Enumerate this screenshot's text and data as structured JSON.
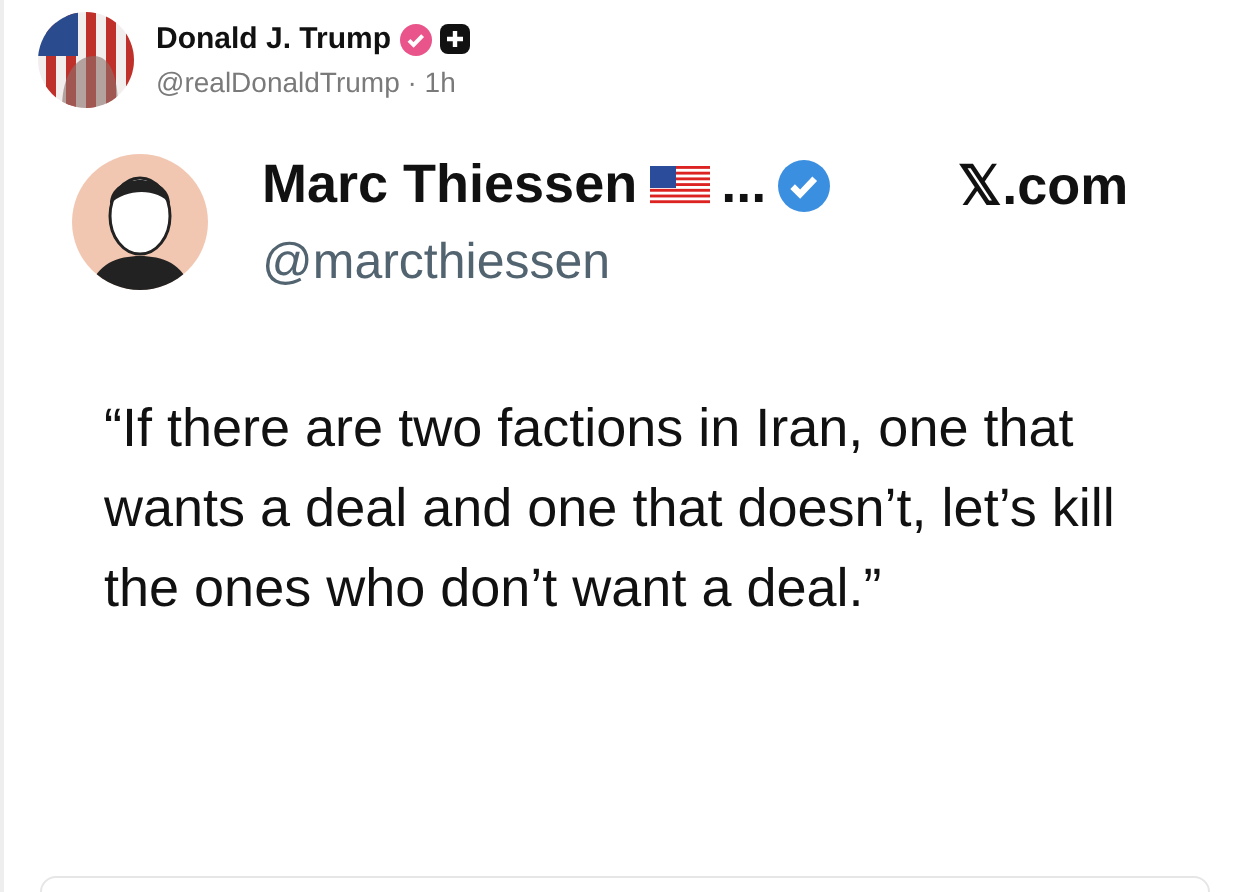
{
  "post": {
    "author": {
      "name": "Donald J. Trump",
      "meta": "@realDonaldTrump · 1h"
    },
    "embed": {
      "name": "Marc Thiessen",
      "ellipsis": "...",
      "handle": "@marcthiessen",
      "source": "𝕏.com",
      "quote": "“If there are two factions in Iran, one that wants a deal and one that doesn’t, let’s kill the ones who don’t want a deal.”"
    }
  }
}
